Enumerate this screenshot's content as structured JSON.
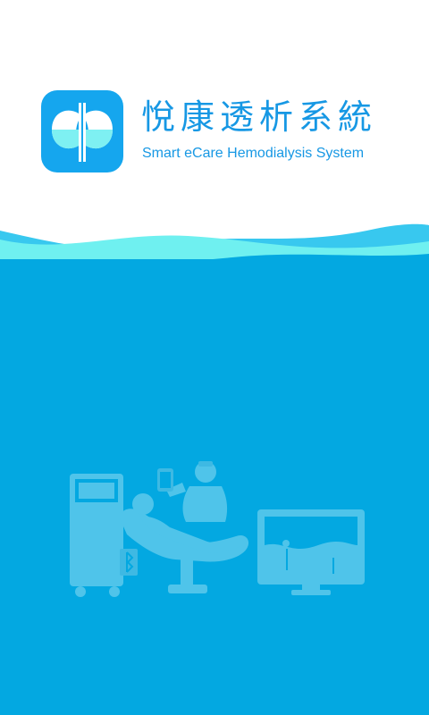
{
  "app": {
    "title_cn": "悅康透析系統",
    "title_en": "Smart eCare Hemodialysis System"
  },
  "icons": {
    "logo": "kidneys-logo-icon",
    "illustration": "hemodialysis-scene-illustration",
    "bluetooth": "bluetooth-icon"
  },
  "colors": {
    "brand": "#15a6ee",
    "text": "#1798e4",
    "ocean": "#03a8e1",
    "wave_light": "#6ff0f0",
    "wave_mid": "#38c8ef"
  }
}
